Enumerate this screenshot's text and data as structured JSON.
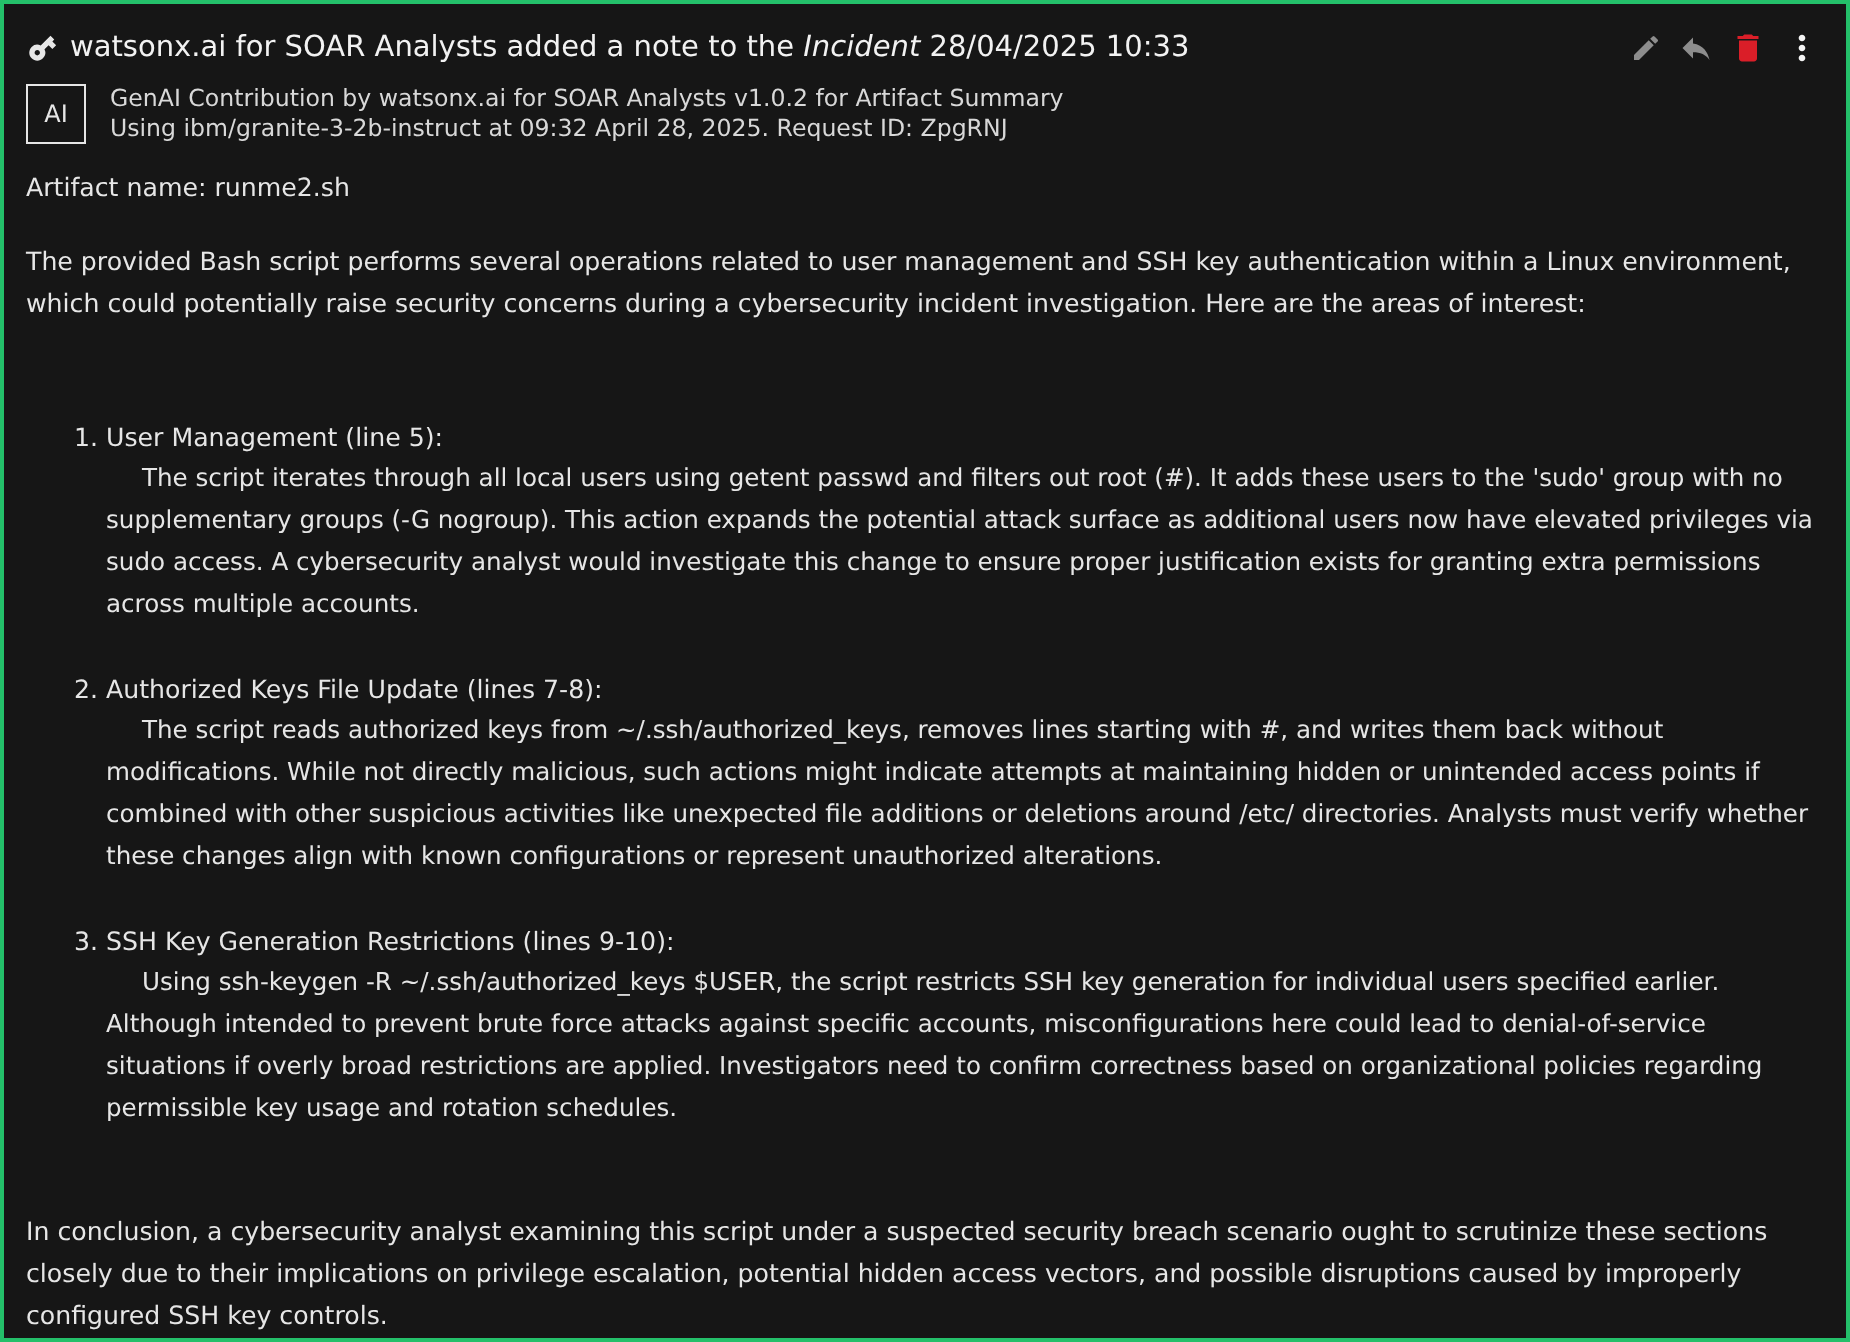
{
  "header": {
    "title": "watsonx.ai for SOAR Analysts added a note to the *Incident* 28/04/2025 10:33"
  },
  "contribution": {
    "badge": "AI",
    "line_1": "GenAI Contribution by watsonx.ai for SOAR Analysts v1.0.2 for Artifact Summary",
    "line_2": "Using ibm/granite-3-2b-instruct at 09:32 April 28, 2025. Request ID: ZpgRNJ"
  },
  "artifact_name": "Artifact name: runme2.sh",
  "intro": "The provided Bash script performs several operations related to user management and SSH key authentication within a Linux environment, which could potentially raise security concerns during a cybersecurity incident investigation. Here are the areas of interest:",
  "items": [
    {
      "number": "1.",
      "heading": "User Management (line 5):",
      "body": "The script iterates through all local users using getent passwd and filters out root (#). It adds these users to the 'sudo' group with no supplementary groups (-G nogroup). This action expands the potential attack surface as additional users now have elevated privileges via sudo access. A cybersecurity analyst would investigate this change to ensure proper justification exists for granting extra permissions across multiple accounts."
    },
    {
      "number": "2.",
      "heading": "Authorized Keys File Update (lines 7-8):",
      "body": "The script reads authorized keys from ~/.ssh/authorized_keys, removes lines starting with #, and writes them back without modifications. While not directly malicious, such actions might indicate attempts at maintaining hidden or unintended access points if combined with other suspicious activities like unexpected file additions or deletions around /etc/ directories. Analysts must verify whether these changes align with known configurations or represent unauthorized alterations."
    },
    {
      "number": "3.",
      "heading": "SSH Key Generation Restrictions (lines 9-10):",
      "body": "Using ssh-keygen -R ~/.ssh/authorized_keys $USER, the script restricts SSH key generation for individual users specified earlier. Although intended to prevent brute force attacks against specific accounts, misconfigurations here could lead to denial-of-service situations if overly broad restrictions are applied. Investigators need to confirm correctness based on organizational policies regarding permissible key usage and rotation schedules."
    }
  ],
  "conclusion": "In conclusion, a cybersecurity analyst examining this script under a suspected security breach scenario ought to scrutinize these sections closely due to their implications on privilege escalation, potential hidden access vectors, and possible disruptions caused by improperly configured SSH key controls."
}
